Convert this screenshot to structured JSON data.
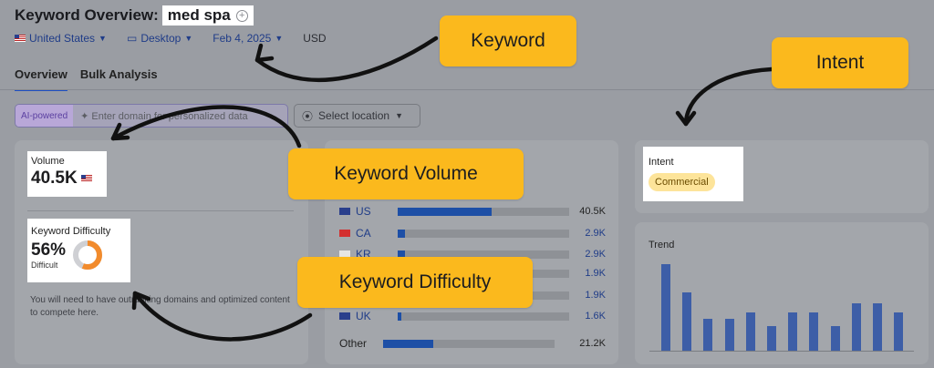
{
  "header": {
    "title": "Keyword Overview:",
    "keyword": "med spa",
    "filters": {
      "country": "United States",
      "device": "Desktop",
      "date": "Feb 4, 2025",
      "currency": "USD"
    }
  },
  "tabs": [
    "Overview",
    "Bulk Analysis"
  ],
  "ai_bar": {
    "tag": "AI-powered",
    "placeholder": "Enter domain for personalized data"
  },
  "location_select": "Select location",
  "volume": {
    "label": "Volume",
    "value": "40.5K"
  },
  "keyword_difficulty": {
    "label": "Keyword Difficulty",
    "value": "56%",
    "sublabel": "Difficult",
    "percent": 56,
    "note": "You will need to have outranking domains and optimized content to compete here."
  },
  "countries": [
    {
      "code": "US",
      "value": "40.5K",
      "share": 0.55
    },
    {
      "code": "CA",
      "value": "2.9K",
      "share": 0.04
    },
    {
      "code": "KR",
      "value": "2.9K",
      "share": 0.04
    },
    {
      "code": "",
      "value": "1.9K",
      "share": 0.03
    },
    {
      "code": "",
      "value": "1.9K",
      "share": 0.03
    },
    {
      "code": "UK",
      "value": "1.6K",
      "share": 0.02
    },
    {
      "code": "Other",
      "value": "21.2K",
      "share": 0.29
    }
  ],
  "intent": {
    "label": "Intent",
    "value": "Commercial"
  },
  "trend": {
    "label": "Trend",
    "values": [
      1.0,
      0.67,
      0.37,
      0.37,
      0.44,
      0.28,
      0.44,
      0.44,
      0.28,
      0.55,
      0.55,
      0.44
    ]
  },
  "callouts": {
    "keyword": "Keyword",
    "intent": "Intent",
    "volume": "Keyword Volume",
    "difficulty": "Keyword Difficulty"
  },
  "colors": {
    "callout": "#fbb91d",
    "accent": "#1d4fa6",
    "badge": "#fde49a",
    "difficulty_ring": "#f28b2c"
  }
}
